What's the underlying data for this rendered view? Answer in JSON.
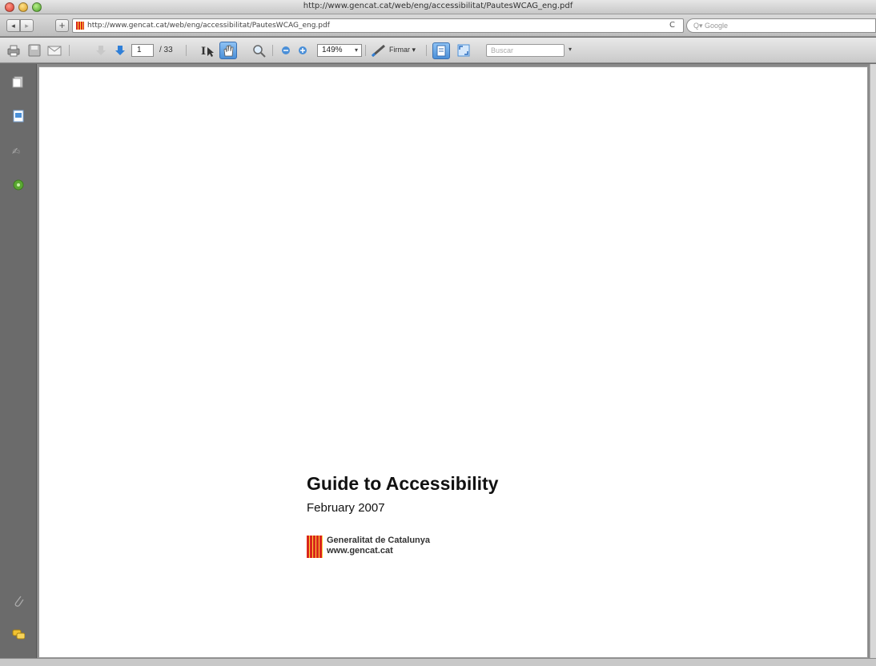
{
  "window": {
    "title": "http://www.gencat.cat/web/eng/accessibilitat/PautesWCAG_eng.pdf"
  },
  "navbar": {
    "back_icon": "◂",
    "forward_icon": "▸",
    "add_icon": "+",
    "url": "http://www.gencat.cat/web/eng/accessibilitat/PautesWCAG_eng.pdf",
    "reload_icon": "C",
    "search_placeholder": "Q▾ Google"
  },
  "toolbar": {
    "page_current": "1",
    "page_total": "/ 33",
    "zoom": "149%",
    "zoom_caret": "▾",
    "sign_label": "Firmar ▾",
    "find_placeholder": "Buscar",
    "find_caret": "▾"
  },
  "document": {
    "title": "Guide to Accessibility",
    "date": "February 2007",
    "org_name": "Generalitat de Catalunya",
    "org_url": "www.gencat.cat"
  },
  "colors": {
    "page_bg": "#ffffff",
    "sidebar_bg": "#6b6b6b",
    "logo_red": "#d9261c",
    "logo_yellow": "#ffd23c",
    "select_blue": "#4a8fd8"
  }
}
